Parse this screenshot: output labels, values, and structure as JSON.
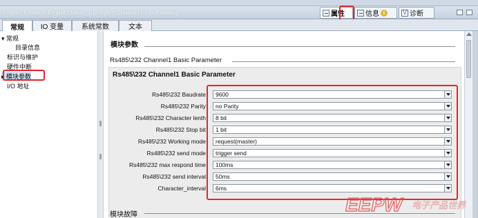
{
  "titlebar": {
    "title": "2 bytes Channel1 input status_1 [2 bytes Channel1 input status]",
    "tabs": [
      {
        "label": "属性",
        "icon": "properties-icon"
      },
      {
        "label": "信息",
        "icon": "info-icon"
      },
      {
        "label": "诊断",
        "icon": "diagnostics-icon"
      }
    ]
  },
  "tabs": [
    "常规",
    "IO 变量",
    "系统常数",
    "文本"
  ],
  "nav": [
    {
      "label": "常规"
    },
    {
      "label": "目录信息"
    },
    {
      "label": "标识与维护"
    },
    {
      "label": "硬件中断"
    },
    {
      "label": "模块参数"
    },
    {
      "label": "I/O 地址"
    }
  ],
  "content": {
    "section_title": "模块参数",
    "subsection_title": "Rs485\\232 Channel1 Basic Parameter",
    "group_title": "Rs485\\232 Channel1 Basic Parameter",
    "params": [
      {
        "label": "Rs485\\232  Baudrate",
        "value": "9600"
      },
      {
        "label": "Rs485\\232  Parity",
        "value": "no Parity"
      },
      {
        "label": "Rs485\\232  Character lenth",
        "value": "8 bit"
      },
      {
        "label": "Rs485\\232 Stop bit",
        "value": "1 bit"
      },
      {
        "label": "Rs485\\232 Working mode",
        "value": "request(master)"
      },
      {
        "label": "Rs485\\232 send mode",
        "value": "trigger send"
      },
      {
        "label": "Rs485\\232 max respond time",
        "value": "100ms"
      },
      {
        "label": "Rs485\\232 send interval",
        "value": "50ms"
      },
      {
        "label": "Character_interval",
        "value": "6ms"
      }
    ],
    "footer_section": "模块故障"
  },
  "watermark": {
    "text": "EEPW",
    "subtext": "电子产品世界"
  },
  "colors": {
    "highlight": "#e3262a",
    "titlebar": "#c6d2df",
    "group_bg": "#ececec"
  }
}
